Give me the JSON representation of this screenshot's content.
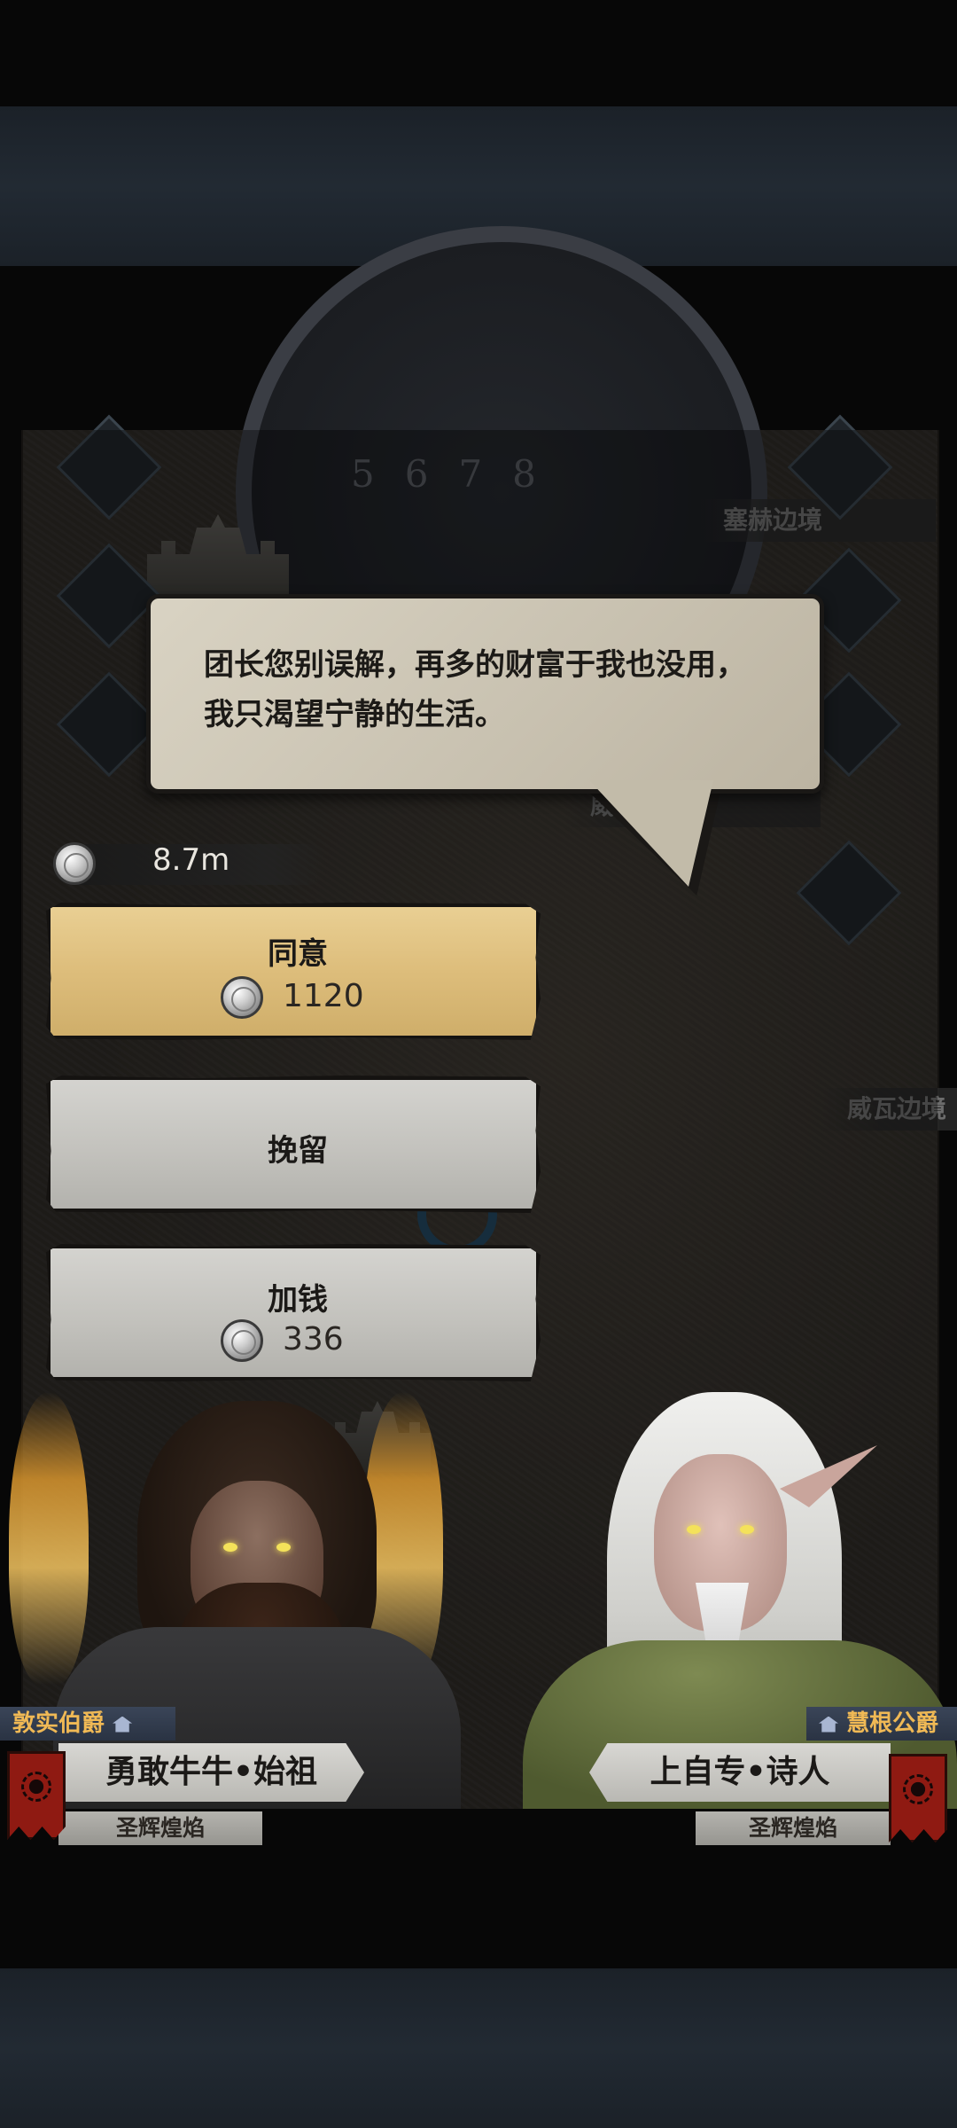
{
  "map": {
    "dial_numbers": "5678",
    "labels": [
      "塞赫边境",
      "威瓦边境",
      "威瓦边境"
    ]
  },
  "dialogue": {
    "line1": "团长您别误解，再多的财富于我也没用，",
    "line2": "我只渴望宁静的生活。"
  },
  "balance": {
    "amount": "8.7m",
    "icon": "silver-coin-icon"
  },
  "choices": [
    {
      "label": "同意",
      "cost": "1120"
    },
    {
      "label": "挽留",
      "cost": ""
    },
    {
      "label": "加钱",
      "cost": "336"
    }
  ],
  "left_character": {
    "title": "敦实伯爵",
    "name": "勇敢牛牛•始祖",
    "faction": "圣辉煌焰"
  },
  "right_character": {
    "title": "慧根公爵",
    "name": "上自专•诗人",
    "faction": "圣辉煌焰"
  },
  "colors": {
    "accent_gold": "#ddbd7b",
    "button_gray": "#c3c2bd",
    "title_gold": "#f0b955",
    "banner_red": "#8f1a12"
  }
}
